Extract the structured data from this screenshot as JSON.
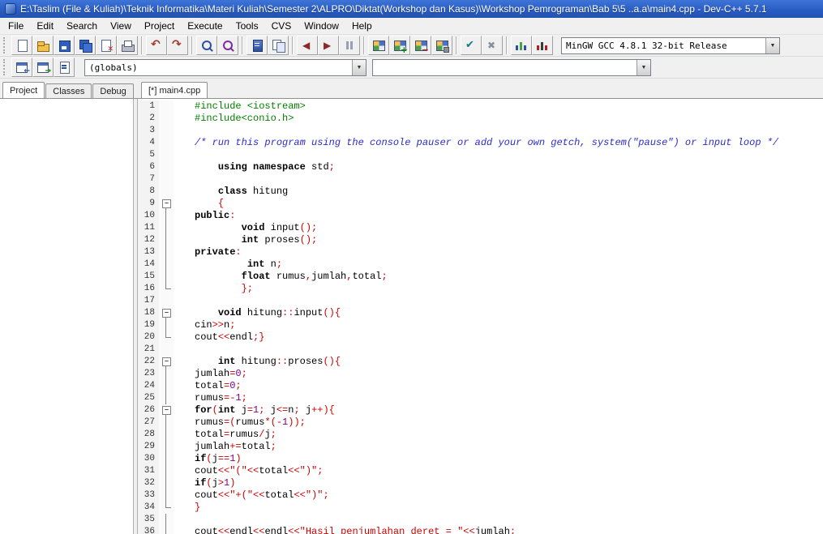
{
  "window": {
    "title": "E:\\Taslim (File & Kuliah)\\Teknik Informatika\\Materi Kuliah\\Semester 2\\ALPRO\\Diktat(Workshop dan Kasus)\\Workshop Pemrograman\\Bab 5\\5 ..a.a\\main4.cpp - Dev-C++ 5.7.1"
  },
  "menu": {
    "items": [
      "File",
      "Edit",
      "Search",
      "View",
      "Project",
      "Execute",
      "Tools",
      "CVS",
      "Window",
      "Help"
    ]
  },
  "toolbar": {
    "row1": [
      "grip",
      "new-file",
      "open",
      "save",
      "save-all",
      "close-file",
      "print",
      "sep",
      "undo",
      "redo",
      "sep",
      "find",
      "replace",
      "sep",
      "goto-line",
      "swap-header-source",
      "sep",
      "back",
      "forward",
      "abort",
      "sep",
      "new-project",
      "add-to-project",
      "remove-from-project",
      "project-properties",
      "sep",
      "compile",
      "clean",
      "sep",
      "profile",
      "delete-profiling"
    ],
    "row2": [
      "grip",
      "insert",
      "toggle-bookmark",
      "goto-bookmark"
    ],
    "compiler_value": "MinGW GCC 4.8.1 32-bit Release"
  },
  "browser": {
    "scope_value": "(globals)",
    "member_value": ""
  },
  "panels": {
    "left_tabs": [
      "Project",
      "Classes",
      "Debug"
    ],
    "active_left_tab": "Project"
  },
  "editor": {
    "tab": "[*] main4.cpp",
    "lines": [
      {
        "n": 1,
        "f": "",
        "t": [
          [
            "pp",
            "#include <iostream>"
          ]
        ]
      },
      {
        "n": 2,
        "f": "",
        "t": [
          [
            "pp",
            "#include<conio.h>"
          ]
        ]
      },
      {
        "n": 3,
        "f": "",
        "t": []
      },
      {
        "n": 4,
        "f": "",
        "t": [
          [
            "cm",
            "/* run this program using the console pauser or add your own getch, system(\"pause\") or input loop */"
          ]
        ]
      },
      {
        "n": 5,
        "f": "",
        "t": []
      },
      {
        "n": 6,
        "f": "",
        "t": [
          [
            "id",
            "    "
          ],
          [
            "kw",
            "using"
          ],
          [
            "id",
            " "
          ],
          [
            "kw",
            "namespace"
          ],
          [
            "id",
            " std"
          ],
          [
            "sy",
            ";"
          ]
        ]
      },
      {
        "n": 7,
        "f": "",
        "t": []
      },
      {
        "n": 8,
        "f": "",
        "t": [
          [
            "id",
            "    "
          ],
          [
            "kw",
            "class"
          ],
          [
            "id",
            " hitung"
          ]
        ]
      },
      {
        "n": 9,
        "f": "s",
        "t": [
          [
            "id",
            "    "
          ],
          [
            "sy",
            "{"
          ]
        ]
      },
      {
        "n": 10,
        "f": "m",
        "t": [
          [
            "kw",
            "public"
          ],
          [
            "sy",
            ":"
          ]
        ]
      },
      {
        "n": 11,
        "f": "m",
        "t": [
          [
            "id",
            "        "
          ],
          [
            "kw",
            "void"
          ],
          [
            "id",
            " input"
          ],
          [
            "sy",
            "();"
          ]
        ]
      },
      {
        "n": 12,
        "f": "m",
        "t": [
          [
            "id",
            "        "
          ],
          [
            "kw",
            "int"
          ],
          [
            "id",
            " proses"
          ],
          [
            "sy",
            "();"
          ]
        ]
      },
      {
        "n": 13,
        "f": "m",
        "t": [
          [
            "kw",
            "private"
          ],
          [
            "sy",
            ":"
          ]
        ]
      },
      {
        "n": 14,
        "f": "m",
        "t": [
          [
            "id",
            "         "
          ],
          [
            "kw",
            "int"
          ],
          [
            "id",
            " n"
          ],
          [
            "sy",
            ";"
          ]
        ]
      },
      {
        "n": 15,
        "f": "m",
        "t": [
          [
            "id",
            "        "
          ],
          [
            "kw",
            "float"
          ],
          [
            "id",
            " rumus"
          ],
          [
            "sy",
            ","
          ],
          [
            "id",
            "jumlah"
          ],
          [
            "sy",
            ","
          ],
          [
            "id",
            "total"
          ],
          [
            "sy",
            ";"
          ]
        ]
      },
      {
        "n": 16,
        "f": "e",
        "t": [
          [
            "id",
            "        "
          ],
          [
            "sy",
            "};"
          ]
        ]
      },
      {
        "n": 17,
        "f": "",
        "t": []
      },
      {
        "n": 18,
        "f": "s",
        "t": [
          [
            "id",
            "    "
          ],
          [
            "kw",
            "void"
          ],
          [
            "id",
            " hitung"
          ],
          [
            "sy",
            "::"
          ],
          [
            "id",
            "input"
          ],
          [
            "sy",
            "(){"
          ]
        ]
      },
      {
        "n": 19,
        "f": "m",
        "t": [
          [
            "id",
            "cin"
          ],
          [
            "sy",
            ">>"
          ],
          [
            "id",
            "n"
          ],
          [
            "sy",
            ";"
          ]
        ]
      },
      {
        "n": 20,
        "f": "e",
        "t": [
          [
            "id",
            "cout"
          ],
          [
            "sy",
            "<<"
          ],
          [
            "id",
            "endl"
          ],
          [
            "sy",
            ";}"
          ]
        ]
      },
      {
        "n": 21,
        "f": "",
        "t": []
      },
      {
        "n": 22,
        "f": "s",
        "t": [
          [
            "id",
            "    "
          ],
          [
            "kw",
            "int"
          ],
          [
            "id",
            " hitung"
          ],
          [
            "sy",
            "::"
          ],
          [
            "id",
            "proses"
          ],
          [
            "sy",
            "(){"
          ]
        ]
      },
      {
        "n": 23,
        "f": "m",
        "t": [
          [
            "id",
            "jumlah"
          ],
          [
            "sy",
            "="
          ],
          [
            "nu",
            "0"
          ],
          [
            "sy",
            ";"
          ]
        ]
      },
      {
        "n": 24,
        "f": "m",
        "t": [
          [
            "id",
            "total"
          ],
          [
            "sy",
            "="
          ],
          [
            "nu",
            "0"
          ],
          [
            "sy",
            ";"
          ]
        ]
      },
      {
        "n": 25,
        "f": "m",
        "t": [
          [
            "id",
            "rumus"
          ],
          [
            "sy",
            "=-"
          ],
          [
            "nu",
            "1"
          ],
          [
            "sy",
            ";"
          ]
        ]
      },
      {
        "n": 26,
        "f": "s",
        "t": [
          [
            "kw",
            "for"
          ],
          [
            "sy",
            "("
          ],
          [
            "kw",
            "int"
          ],
          [
            "id",
            " j"
          ],
          [
            "sy",
            "="
          ],
          [
            "nu",
            "1"
          ],
          [
            "sy",
            ";"
          ],
          [
            "id",
            " j"
          ],
          [
            "sy",
            "<="
          ],
          [
            "id",
            "n"
          ],
          [
            "sy",
            ";"
          ],
          [
            "id",
            " j"
          ],
          [
            "sy",
            "++){"
          ]
        ]
      },
      {
        "n": 27,
        "f": "m",
        "t": [
          [
            "id",
            "rumus"
          ],
          [
            "sy",
            "=("
          ],
          [
            "id",
            "rumus"
          ],
          [
            "sy",
            "*(-"
          ],
          [
            "nu",
            "1"
          ],
          [
            "sy",
            "));"
          ]
        ]
      },
      {
        "n": 28,
        "f": "m",
        "t": [
          [
            "id",
            "total"
          ],
          [
            "sy",
            "="
          ],
          [
            "id",
            "rumus"
          ],
          [
            "sy",
            "/"
          ],
          [
            "id",
            "j"
          ],
          [
            "sy",
            ";"
          ]
        ]
      },
      {
        "n": 29,
        "f": "m",
        "t": [
          [
            "id",
            "jumlah"
          ],
          [
            "sy",
            "+="
          ],
          [
            "id",
            "total"
          ],
          [
            "sy",
            ";"
          ]
        ]
      },
      {
        "n": 30,
        "f": "m",
        "t": [
          [
            "kw",
            "if"
          ],
          [
            "sy",
            "("
          ],
          [
            "id",
            "j"
          ],
          [
            "sy",
            "=="
          ],
          [
            "nu",
            "1"
          ],
          [
            "sy",
            ")"
          ]
        ]
      },
      {
        "n": 31,
        "f": "m",
        "t": [
          [
            "id",
            "cout"
          ],
          [
            "sy",
            "<<"
          ],
          [
            "st",
            "\"(\""
          ],
          [
            "sy",
            "<<"
          ],
          [
            "id",
            "total"
          ],
          [
            "sy",
            "<<"
          ],
          [
            "st",
            "\")\""
          ],
          [
            "sy",
            ";"
          ]
        ]
      },
      {
        "n": 32,
        "f": "m",
        "t": [
          [
            "kw",
            "if"
          ],
          [
            "sy",
            "("
          ],
          [
            "id",
            "j"
          ],
          [
            "sy",
            ">"
          ],
          [
            "nu",
            "1"
          ],
          [
            "sy",
            ")"
          ]
        ]
      },
      {
        "n": 33,
        "f": "m",
        "t": [
          [
            "id",
            "cout"
          ],
          [
            "sy",
            "<<"
          ],
          [
            "st",
            "\"+(\""
          ],
          [
            "sy",
            "<<"
          ],
          [
            "id",
            "total"
          ],
          [
            "sy",
            "<<"
          ],
          [
            "st",
            "\")\""
          ],
          [
            "sy",
            ";"
          ]
        ]
      },
      {
        "n": 34,
        "f": "e",
        "t": [
          [
            "sy",
            "}"
          ]
        ]
      },
      {
        "n": 35,
        "f": "m",
        "t": []
      },
      {
        "n": 36,
        "f": "m",
        "t": [
          [
            "id",
            "cout"
          ],
          [
            "sy",
            "<<"
          ],
          [
            "id",
            "endl"
          ],
          [
            "sy",
            "<<"
          ],
          [
            "id",
            "endl"
          ],
          [
            "sy",
            "<<"
          ],
          [
            "st",
            "\"Hasil penjumlahan deret = \""
          ],
          [
            "sy",
            "<<"
          ],
          [
            "id",
            "jumlah"
          ],
          [
            "sy",
            ";"
          ]
        ]
      }
    ]
  },
  "colors": {
    "pp": "#007f00",
    "cm": "#2a2ad6",
    "kw": "#000000",
    "id": "#000000",
    "sy": "#cc0000",
    "nu": "#86008a",
    "st": "#cc0000",
    "titlebar": "#2a5ec4"
  }
}
